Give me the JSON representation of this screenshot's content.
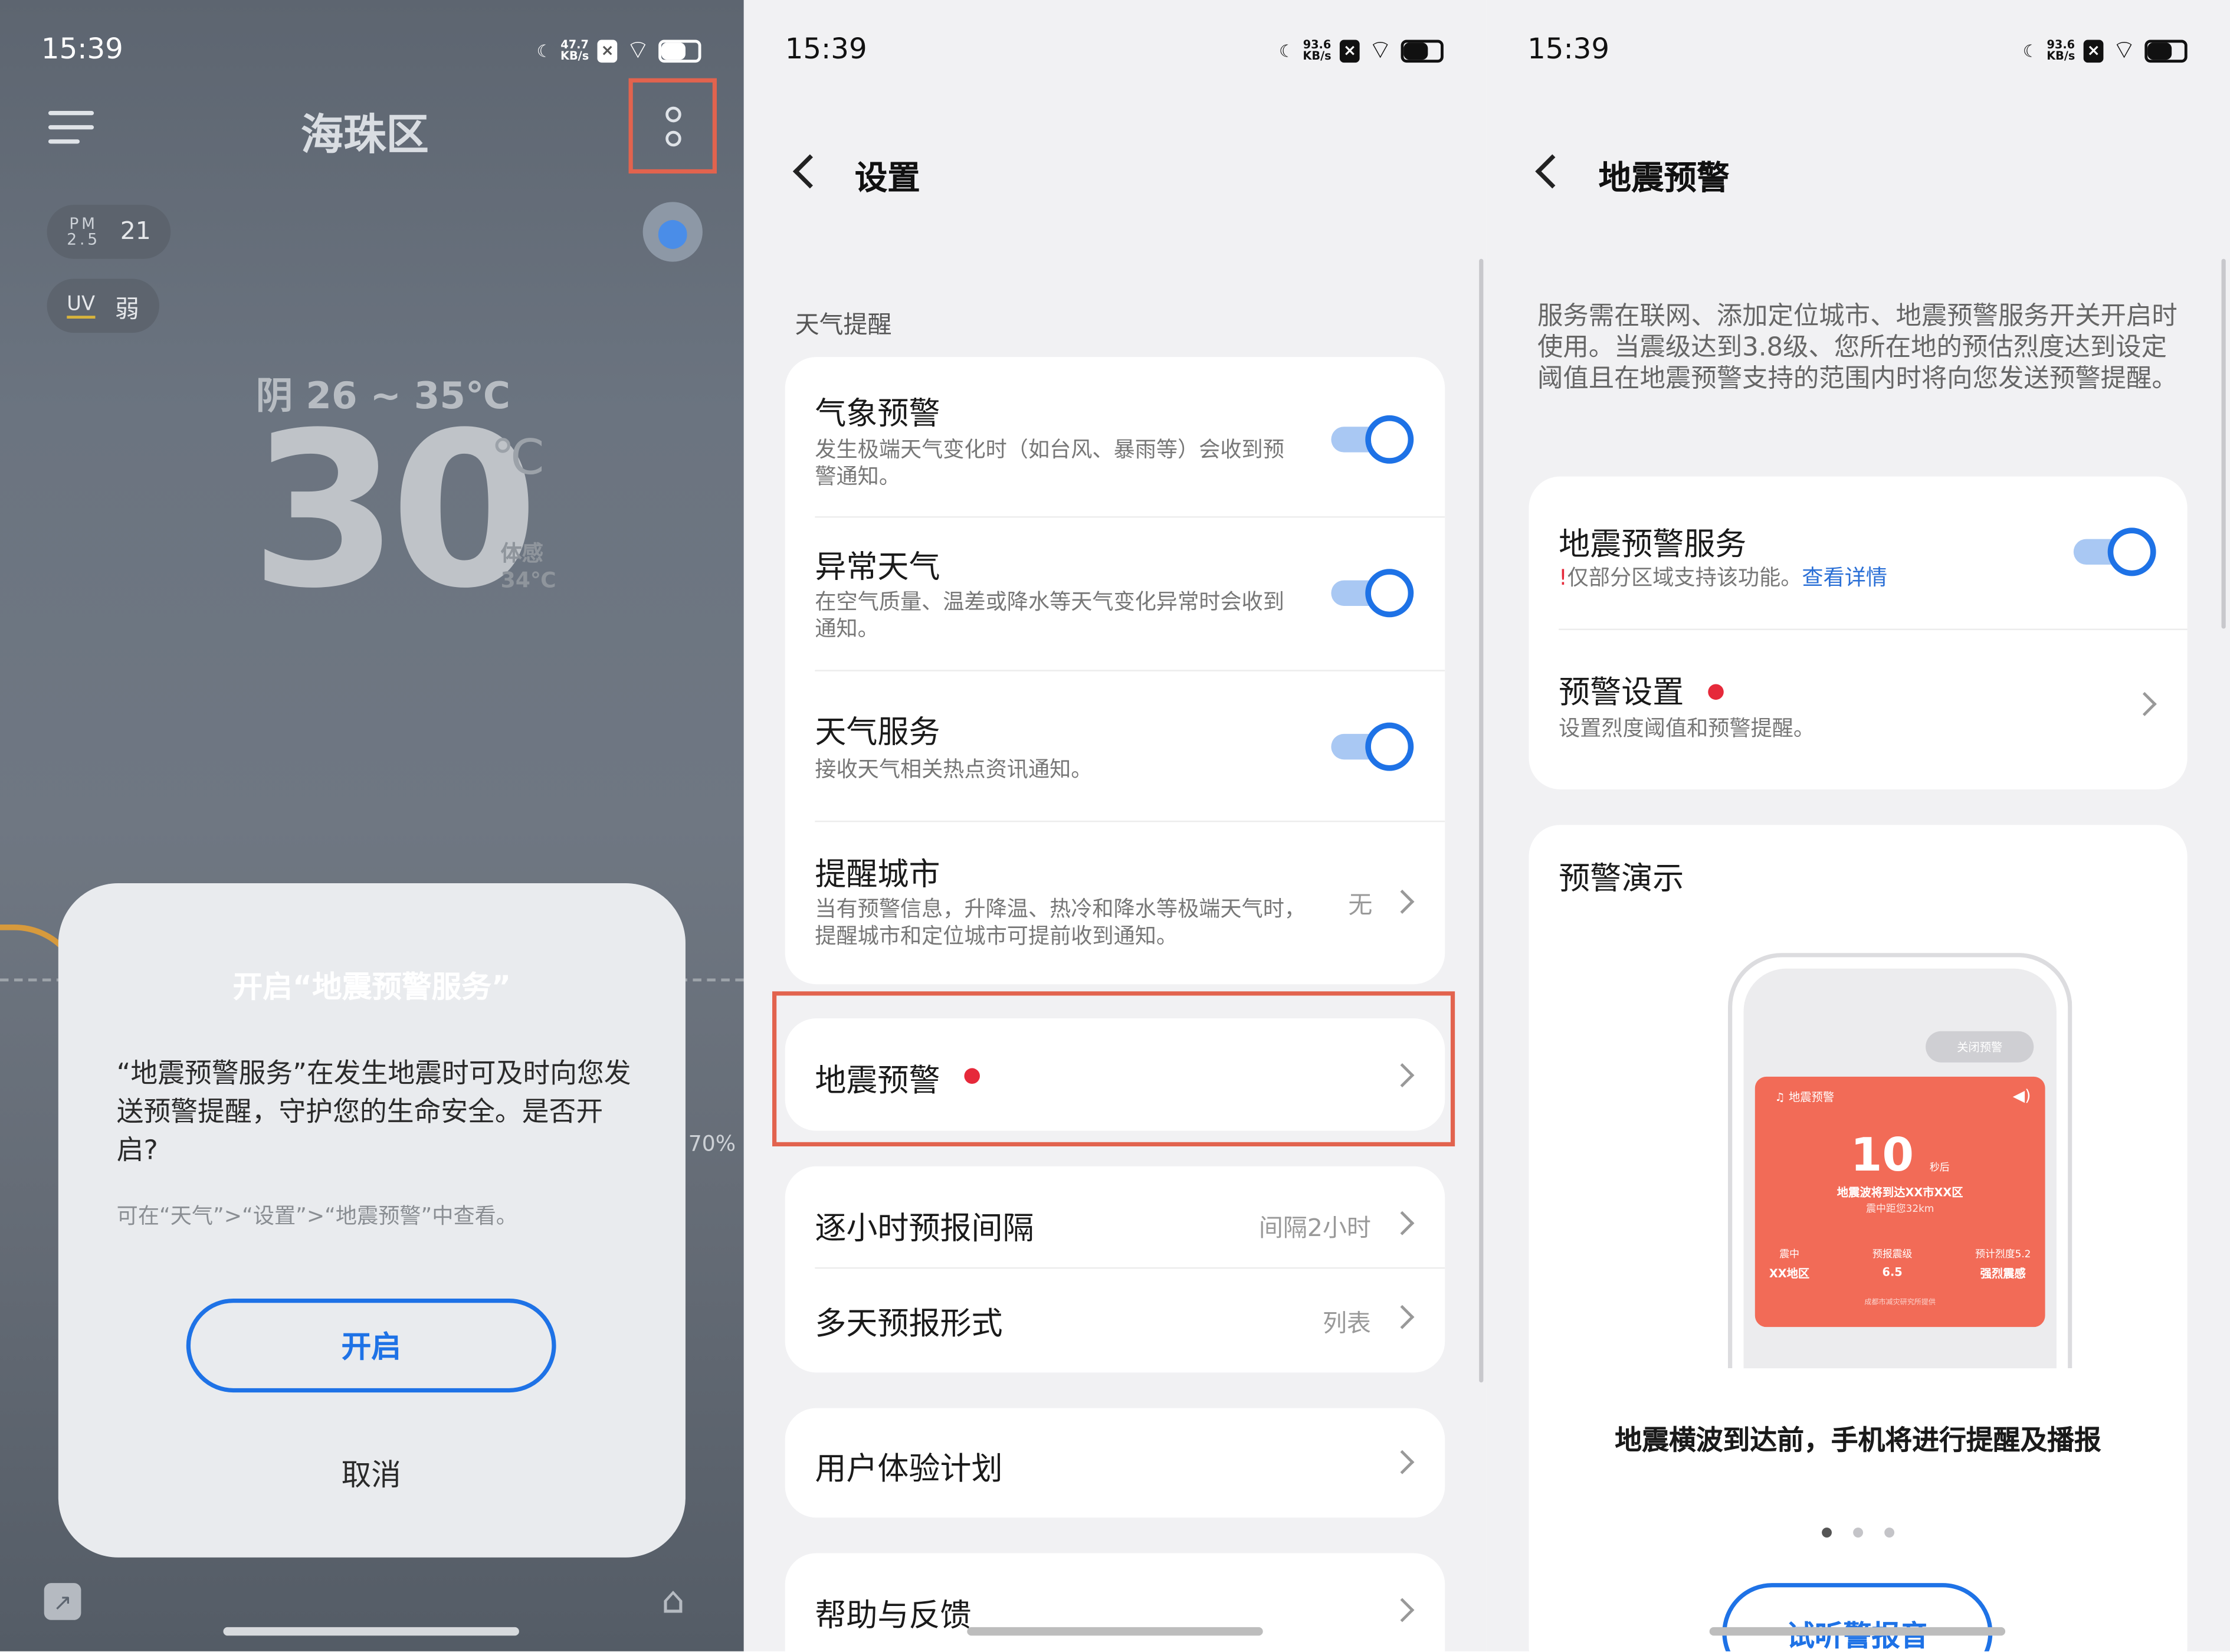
{
  "panel_weather": {
    "status": {
      "time": "15:39",
      "speed": "47.7",
      "speed_unit": "KB/s"
    },
    "city": "海珠区",
    "pm25": {
      "label_top": "PM",
      "label_bottom": "2.5",
      "value": "21"
    },
    "uv": {
      "label": "UV",
      "value": "弱"
    },
    "condition": "阴  26 ~ 35℃",
    "temperature": "30",
    "temperature_unit": "℃",
    "feels_label": "体感",
    "feels_value": "34℃",
    "side_value": "70%",
    "dialog": {
      "title": "开启“地震预警服务”",
      "body": "“地震预警服务”在发生地震时可及时向您发送预警提醒，守护您的生命安全。是否开启?",
      "hint": "可在“天气”>“设置”>“地震预警”中查看。",
      "confirm": "开启",
      "cancel": "取消"
    }
  },
  "panel_settings": {
    "status": {
      "time": "15:39",
      "speed": "93.6",
      "speed_unit": "KB/s"
    },
    "title": "设置",
    "section": "天气提醒",
    "weather_alerts": [
      {
        "title": "气象预警",
        "subtitle": "发生极端天气变化时（如台风、暴雨等）会收到预警通知。",
        "enabled": true
      },
      {
        "title": "异常天气",
        "subtitle": "在空气质量、温差或降水等天气变化异常时会收到通知。",
        "enabled": true
      },
      {
        "title": "天气服务",
        "subtitle": "接收天气相关热点资讯通知。",
        "enabled": true
      },
      {
        "title": "提醒城市",
        "subtitle": "当有预警信息，升降温、热冷和降水等极端天气时，提醒城市和定位城市可提前收到通知。",
        "value": "无"
      }
    ],
    "earthquake": {
      "title": "地震预警"
    },
    "forecast": [
      {
        "title": "逐小时预报间隔",
        "value": "间隔2小时"
      },
      {
        "title": "多天预报形式",
        "value": "列表"
      }
    ],
    "ux_plan": "用户体验计划",
    "help": "帮助与反馈"
  },
  "panel_earthquake": {
    "status": {
      "time": "15:39",
      "speed": "93.6",
      "speed_unit": "KB/s"
    },
    "title": "地震预警",
    "description": "服务需在联网、添加定位城市、地震预警服务开关开启时使用。当震级达到3.8级、您所在地的预估烈度达到设定阈值且在地震预警支持的范围内时将向您发送预警提醒。",
    "service": {
      "title": "地震预警服务",
      "warn_mark": "!",
      "note": "仅部分区域支持该功能。",
      "link": "查看详情",
      "enabled": true
    },
    "settings": {
      "title": "预警设置",
      "subtitle": "设置烈度阈值和预警提醒。"
    },
    "demo": {
      "title": "预警演示",
      "phone": {
        "close_pill": "关闭预警",
        "header": "地震预警",
        "countdown": "10",
        "countdown_unit": "秒后",
        "line1": "地震波将到达XX市XX区",
        "line2": "震中距您32km",
        "col1_label": "震中",
        "col1_value": "XX地区",
        "col2_label": "预报震级",
        "col2_value": "6.5",
        "col3_label": "预计烈度5.2",
        "col3_value": "强烈震感",
        "footer": "成都市减灾研究所提供"
      },
      "caption": "地震横波到达前，手机将进行提醒及播报",
      "page_index": 1,
      "page_count": 3,
      "listen_button": "试听警报音"
    }
  }
}
